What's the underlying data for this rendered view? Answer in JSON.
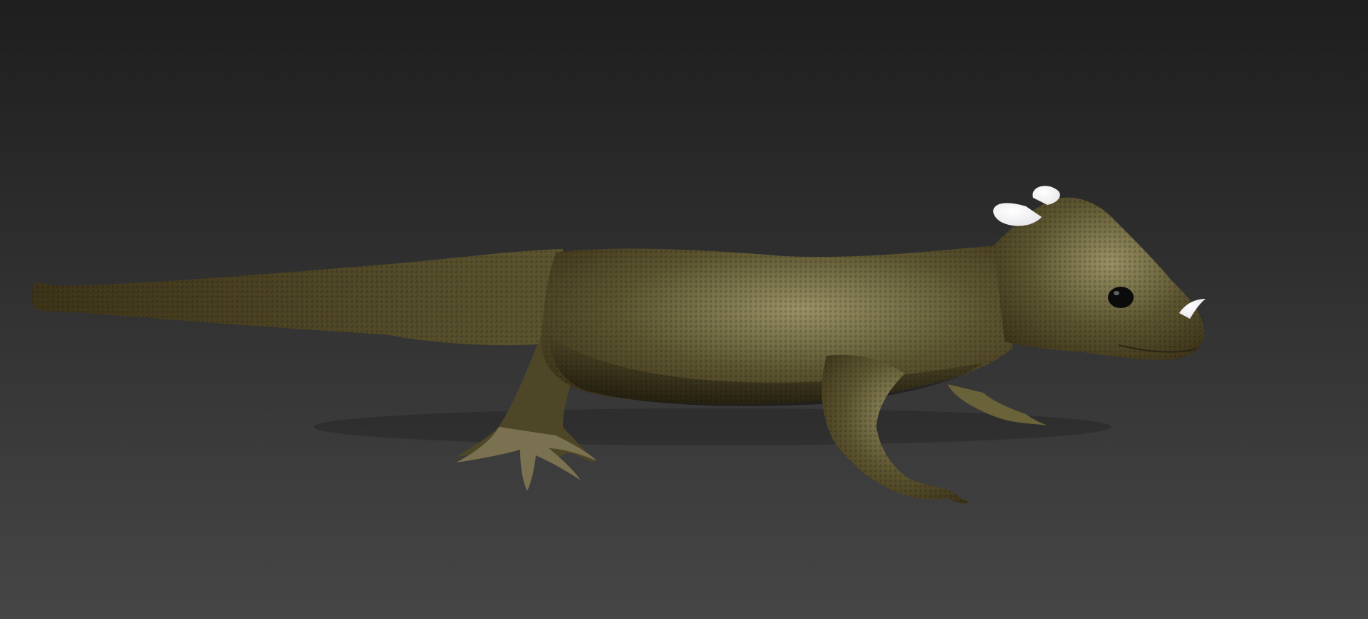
{
  "viewport": {
    "background_top_color": "#1e1e1e",
    "background_bottom_color": "#464646"
  },
  "model": {
    "name": "lizard-model",
    "skin_base_color": "#5e5630",
    "skin_dark_color": "#3d3318",
    "skin_highlight_color": "#9a9264",
    "horn_color": "#e8e6ea",
    "eye_color": "#0b0b0b"
  }
}
